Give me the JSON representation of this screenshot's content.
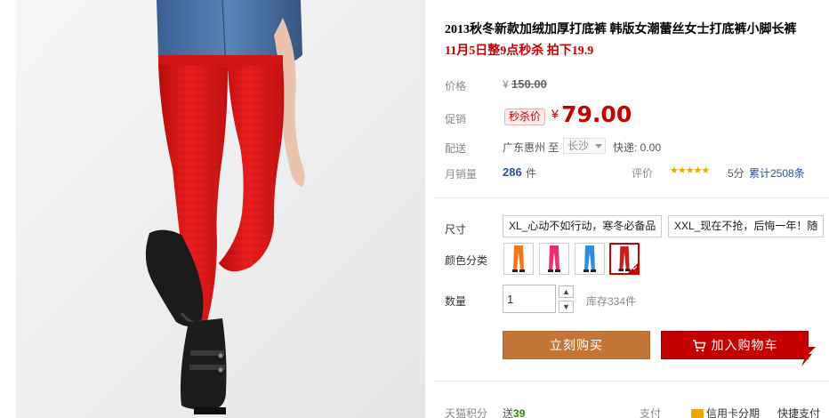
{
  "product": {
    "title": "2013秋冬新款加绒加厚打底裤 韩版女潮蕾丝女士打底裤小脚长裤",
    "subtitle": "11月5日整9点秒杀 拍下19.9"
  },
  "price": {
    "label": "价格",
    "currency": "¥",
    "original": "150.00"
  },
  "promo": {
    "label": "促销",
    "badge": "秒杀价",
    "currency": "¥",
    "price": "79.00"
  },
  "shipping": {
    "label": "配送",
    "from": "广东惠州 至",
    "to": "长沙",
    "fee": "快递: 0.00"
  },
  "sales": {
    "label": "月销量",
    "count": "286",
    "unit": "件",
    "rating_label": "评价",
    "stars": "★★★★★",
    "score": "5分",
    "reviews": "累计2508条"
  },
  "options": {
    "size_label": "尺寸",
    "sizes": [
      "XL_心动不如行动，寒冬必备品",
      "XXL_现在不抢，后悔一年！随"
    ],
    "color_label": "颜色分类",
    "colors": [
      "#f07a1a",
      "#e8326e",
      "#2b8fe0",
      "#d11a1a"
    ],
    "selected_color": 3
  },
  "quantity": {
    "label": "数量",
    "value": "1",
    "stock": "库存334件"
  },
  "actions": {
    "buy": "立刻购买",
    "cart": "加入购物车"
  },
  "footer": {
    "points_label": "天猫积分",
    "points_prefix": "送",
    "points_value": "39",
    "pay_label": "支付",
    "credit": "信用卡分期",
    "quick_pay": "快捷支付"
  },
  "colors": {
    "accent": "#c40000",
    "buy": "#c27738",
    "link": "#2953a6"
  }
}
